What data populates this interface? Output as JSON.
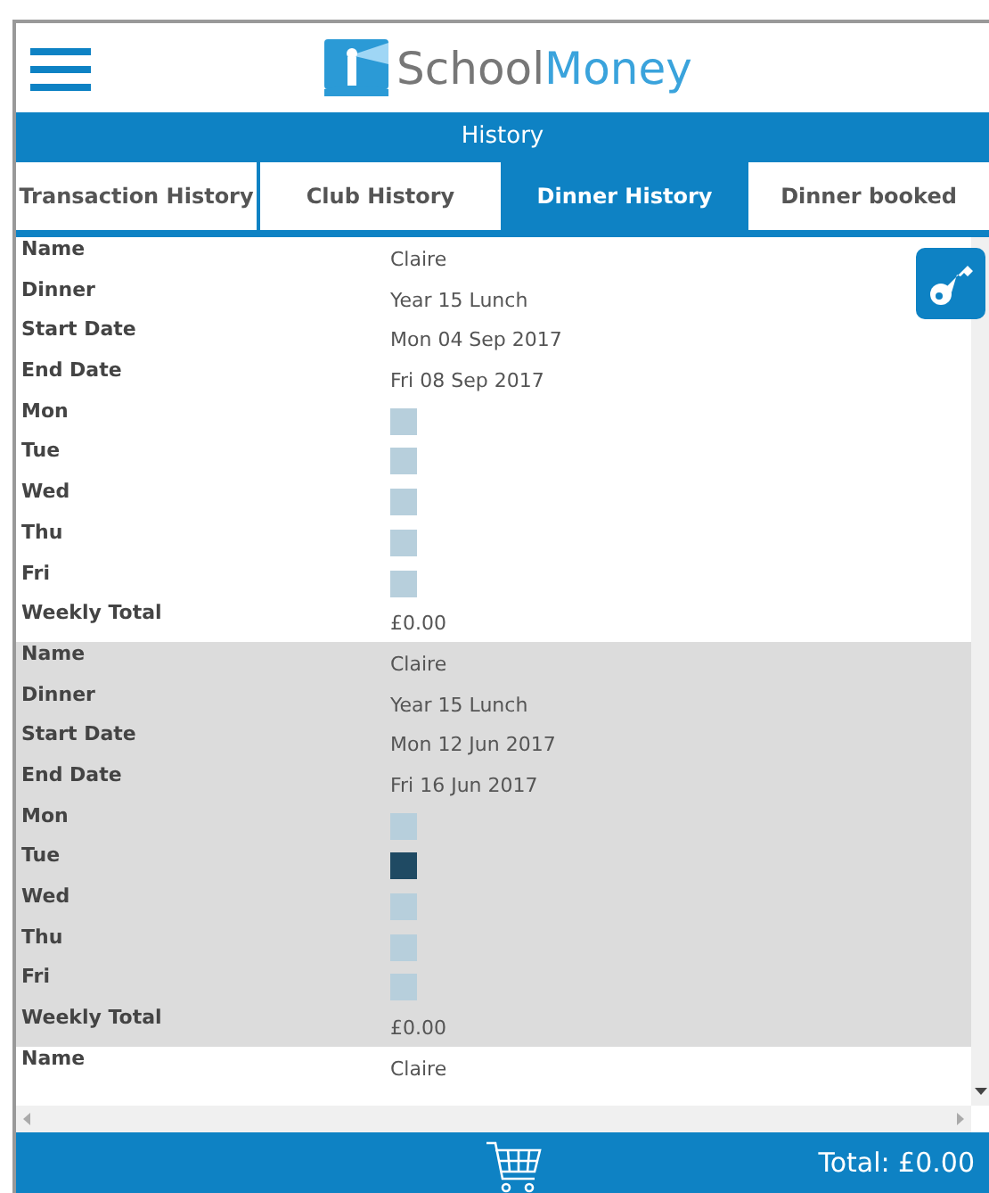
{
  "header": {
    "logo_text_1": "School",
    "logo_text_2": "Money"
  },
  "title_bar": "History",
  "tabs": [
    {
      "label": "Transaction History",
      "selected": false
    },
    {
      "label": "Club History",
      "selected": false
    },
    {
      "label": "Dinner History",
      "selected": true
    },
    {
      "label": "Dinner booked",
      "selected": false
    }
  ],
  "records": [
    {
      "rows": [
        {
          "kind": "text",
          "label": "Name",
          "value": "Claire"
        },
        {
          "kind": "text",
          "label": "Dinner",
          "value": "Year 15 Lunch"
        },
        {
          "kind": "text",
          "label": "Start Date",
          "value": "Mon 04 Sep 2017"
        },
        {
          "kind": "text",
          "label": "End Date",
          "value": "Fri 08 Sep 2017"
        },
        {
          "kind": "day",
          "label": "Mon",
          "booked": false
        },
        {
          "kind": "day",
          "label": "Tue",
          "booked": false
        },
        {
          "kind": "day",
          "label": "Wed",
          "booked": false
        },
        {
          "kind": "day",
          "label": "Thu",
          "booked": false
        },
        {
          "kind": "day",
          "label": "Fri",
          "booked": false
        },
        {
          "kind": "text",
          "label": "Weekly Total",
          "value": "£0.00"
        }
      ]
    },
    {
      "rows": [
        {
          "kind": "text",
          "label": "Name",
          "value": "Claire"
        },
        {
          "kind": "text",
          "label": "Dinner",
          "value": "Year 15 Lunch"
        },
        {
          "kind": "text",
          "label": "Start Date",
          "value": "Mon 12 Jun 2017"
        },
        {
          "kind": "text",
          "label": "End Date",
          "value": "Fri 16 Jun 2017"
        },
        {
          "kind": "day",
          "label": "Mon",
          "booked": false
        },
        {
          "kind": "day",
          "label": "Tue",
          "booked": true
        },
        {
          "kind": "day",
          "label": "Wed",
          "booked": false
        },
        {
          "kind": "day",
          "label": "Thu",
          "booked": false
        },
        {
          "kind": "day",
          "label": "Fri",
          "booked": false
        },
        {
          "kind": "text",
          "label": "Weekly Total",
          "value": "£0.00"
        }
      ]
    },
    {
      "rows": [
        {
          "kind": "text",
          "label": "Name",
          "value": "Claire"
        }
      ]
    }
  ],
  "footer": {
    "total": "Total: £0.00"
  }
}
